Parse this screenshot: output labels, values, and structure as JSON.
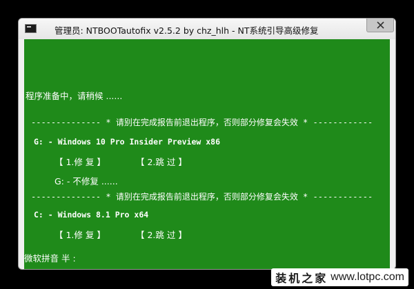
{
  "window": {
    "title": "管理员:  NTBOOTautofix v2.5.2 by chz_hlh - NT系统引导高级修复"
  },
  "console": {
    "preparing": "程序准备中，请稍候 ......",
    "separator_1": "-------------- * 请别在完成报告前退出程序，否则部分修复会失效 * ------------",
    "entry_1": {
      "system": "G: - Windows 10 Pro Insider Preview x86",
      "option_repair": "【  1.修  复  】",
      "option_skip": "【  2.跳  过  】",
      "status": "G: - 不修复 ......"
    },
    "separator_2": "-------------- * 请别在完成报告前退出程序，否则部分修复会失效 * ------------",
    "entry_2": {
      "system": "C: - Windows 8.1 Pro x64",
      "option_repair": "【  1.修  复  】",
      "option_skip": "【  2.跳  过  】"
    },
    "ime_status": "微软拼音 半 :"
  },
  "watermark": {
    "cn": "装机之家",
    "url": "www.lotpc.com"
  },
  "colors": {
    "console_background": "#1f8a1a",
    "console_text": "#ffffff"
  },
  "icons": {
    "app": "console-app-icon",
    "close": "close-icon"
  }
}
